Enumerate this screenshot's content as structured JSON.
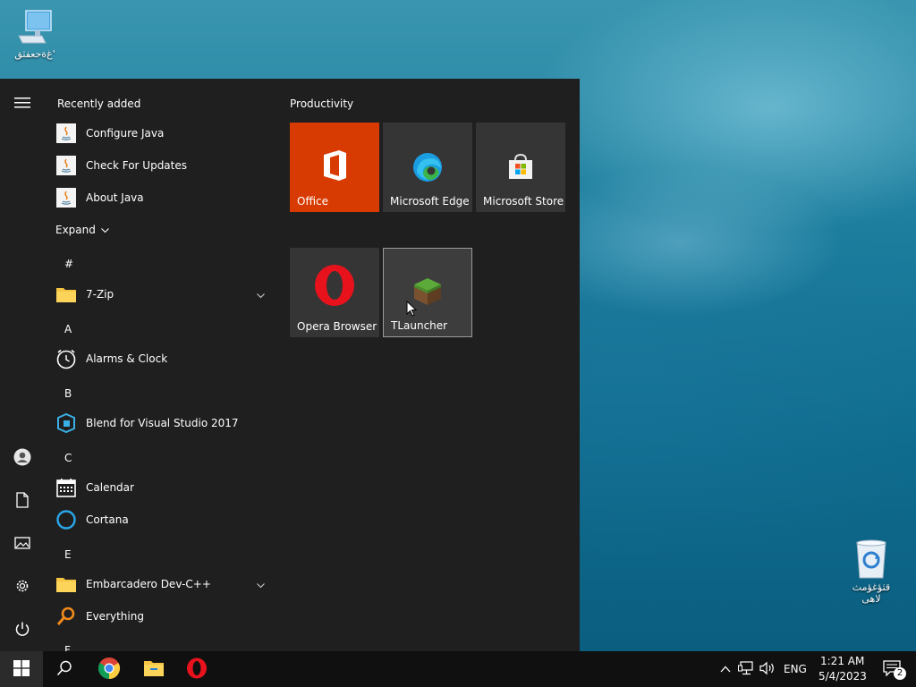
{
  "desktop": {
    "computer_icon_label": "غ‌ةحعفثق'",
    "recycle_bin_label_line1": "قثؤغؤمث",
    "recycle_bin_label_line2": "لاهى"
  },
  "start_menu": {
    "recently_added_label": "Recently added",
    "recent_items": [
      {
        "label": "Configure Java",
        "icon": "java-icon"
      },
      {
        "label": "Check For Updates",
        "icon": "java-icon"
      },
      {
        "label": "About Java",
        "icon": "java-icon"
      }
    ],
    "expand_label": "Expand",
    "sections": {
      "hash": "#",
      "a": "A",
      "b": "B",
      "c": "C",
      "e": "E",
      "f": "F"
    },
    "apps": {
      "zip": "7-Zip",
      "alarms": "Alarms & Clock",
      "blend": "Blend for Visual Studio 2017",
      "calendar": "Calendar",
      "cortana": "Cortana",
      "embarcadero": "Embarcadero Dev-C++",
      "everything": "Everything"
    },
    "group_title": "Productivity",
    "tiles": {
      "office": "Office",
      "edge": "Microsoft Edge",
      "store": "Microsoft Store",
      "opera": "Opera Browser",
      "tlauncher": "TLauncher"
    }
  },
  "taskbar": {
    "language": "ENG",
    "time": "1:21 AM",
    "date": "5/4/2023",
    "notification_count": "2"
  },
  "colors": {
    "office_tile": "#d83b01",
    "tile_bg": "#353535",
    "start_bg": "#1f1f1f",
    "taskbar_bg": "#101010"
  }
}
